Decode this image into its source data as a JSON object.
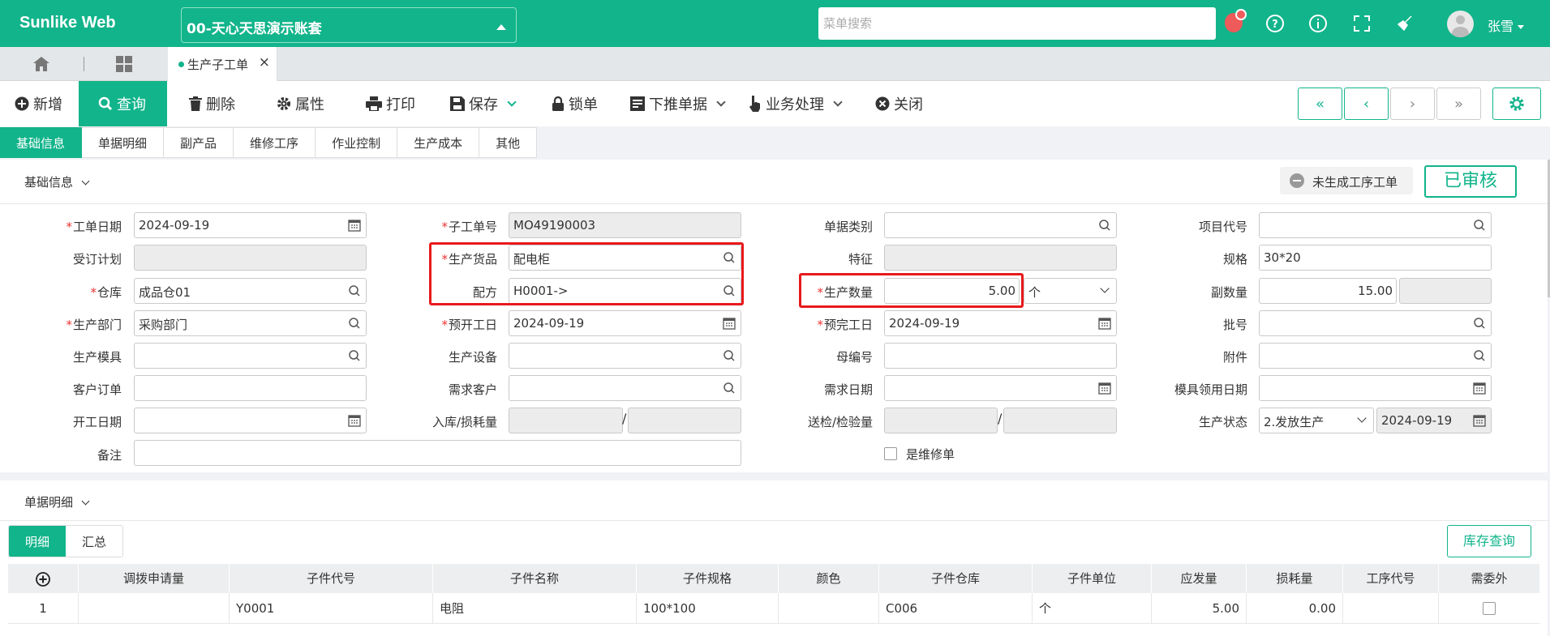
{
  "app": {
    "title": "Sunlike Web",
    "account": "00-天心天思演示账套",
    "menu_search_placeholder": "菜单搜索",
    "user": "张雪"
  },
  "open_tab": "生产子工单",
  "toolbar": {
    "new": "新增",
    "query": "查询",
    "delete": "删除",
    "property": "属性",
    "print": "打印",
    "save": "保存",
    "lock": "锁单",
    "push_down": "下推单据",
    "business": "业务处理",
    "close": "关闭"
  },
  "section_tabs": [
    "基础信息",
    "单据明细",
    "副产品",
    "维修工序",
    "作业控制",
    "生产成本",
    "其他"
  ],
  "basic": {
    "heading": "基础信息",
    "status_pending": "未生成工序工单",
    "status_approved": "已审核",
    "fields": {
      "work_date": {
        "label": "工单日期",
        "value": "2024-09-19"
      },
      "order_plan": {
        "label": "受订计划",
        "value": ""
      },
      "warehouse": {
        "label": "仓库",
        "value": "成品仓01"
      },
      "department": {
        "label": "生产部门",
        "value": "采购部门"
      },
      "mold": {
        "label": "生产模具",
        "value": ""
      },
      "customer_order": {
        "label": "客户订单",
        "value": ""
      },
      "start_date": {
        "label": "开工日期",
        "value": ""
      },
      "remark": {
        "label": "备注",
        "value": ""
      },
      "sub_order_no": {
        "label": "子工单号",
        "value": "MO49190003"
      },
      "product": {
        "label": "生产货品",
        "value": "配电柜"
      },
      "formula": {
        "label": "配方",
        "value": "H0001->"
      },
      "plan_start": {
        "label": "预开工日",
        "value": "2024-09-19"
      },
      "equipment": {
        "label": "生产设备",
        "value": ""
      },
      "demand_customer": {
        "label": "需求客户",
        "value": ""
      },
      "in_loss": {
        "label": "入库/损耗量",
        "value1": "",
        "value2": ""
      },
      "doc_type": {
        "label": "单据类别",
        "value": ""
      },
      "feature": {
        "label": "特征",
        "value": ""
      },
      "quantity": {
        "label": "生产数量",
        "value": "5.00",
        "unit": "个"
      },
      "plan_finish": {
        "label": "预完工日",
        "value": "2024-09-19"
      },
      "parent_no": {
        "label": "母编号",
        "value": ""
      },
      "demand_date": {
        "label": "需求日期",
        "value": ""
      },
      "inspect": {
        "label": "送检/检验量",
        "value1": "",
        "value2": ""
      },
      "is_repair": {
        "label": "是维修单",
        "checked": false
      },
      "project_code": {
        "label": "项目代号",
        "value": ""
      },
      "spec": {
        "label": "规格",
        "value": "30*20"
      },
      "sub_qty": {
        "label": "副数量",
        "value": "15.00",
        "value2": ""
      },
      "batch": {
        "label": "批号",
        "value": ""
      },
      "attachment": {
        "label": "附件",
        "value": ""
      },
      "mold_date": {
        "label": "模具领用日期",
        "value": ""
      },
      "status": {
        "label": "生产状态",
        "value": "2.发放生产",
        "date": "2024-09-19"
      }
    }
  },
  "detail": {
    "heading": "单据明细",
    "tabs": [
      "明细",
      "汇总"
    ],
    "stock_button": "库存查询",
    "columns": [
      "调拨申请量",
      "子件代号",
      "子件名称",
      "子件规格",
      "颜色",
      "子件仓库",
      "子件单位",
      "应发量",
      "损耗量",
      "工序代号",
      "需委外"
    ],
    "rows": [
      {
        "no": "1",
        "transfer": "",
        "code": "Y0001",
        "name": "电阻",
        "spec": "100*100",
        "color": "",
        "warehouse": "C006",
        "unit": "个",
        "issue": "5.00",
        "loss": "0.00",
        "process": "",
        "outsource": false
      }
    ]
  }
}
